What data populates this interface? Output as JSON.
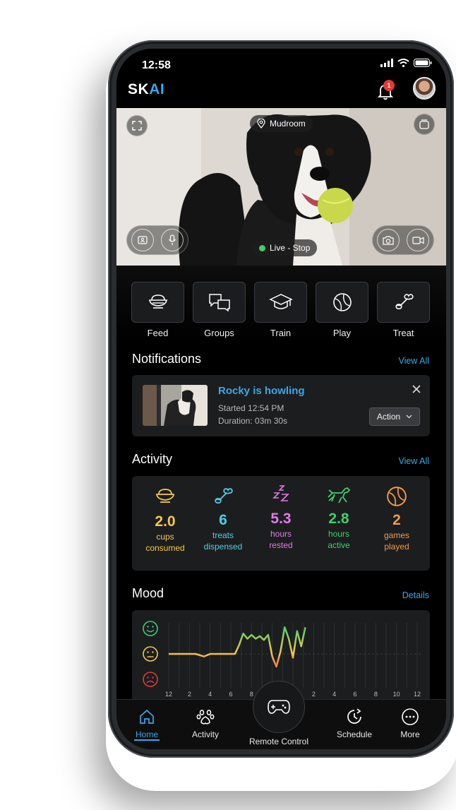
{
  "status_bar": {
    "time": "12:58"
  },
  "header": {
    "logo_sk": "SK",
    "logo_ai": "AI",
    "notification_count": "1"
  },
  "camera": {
    "location": "Mudroom",
    "live_label": "Live - Stop"
  },
  "quick_actions": [
    {
      "label": "Feed",
      "icon": "food-bowl-icon"
    },
    {
      "label": "Groups",
      "icon": "chat-bubbles-icon"
    },
    {
      "label": "Train",
      "icon": "graduation-cap-icon"
    },
    {
      "label": "Play",
      "icon": "ball-icon"
    },
    {
      "label": "Treat",
      "icon": "bone-icon"
    }
  ],
  "notifications": {
    "title": "Notifications",
    "view_all": "View All",
    "item": {
      "title": "Rocky is howling",
      "started": "Started 12:54 PM",
      "duration": "Duration: 03m 30s",
      "action_label": "Action"
    }
  },
  "activity": {
    "title": "Activity",
    "view_all": "View All",
    "stats": [
      {
        "value": "2.0",
        "line1": "cups",
        "line2": "consumed",
        "color": "#f2c94c",
        "icon": "food-bowl-icon"
      },
      {
        "value": "6",
        "line1": "treats",
        "line2": "dispensed",
        "color": "#4fd1e8",
        "icon": "bone-icon"
      },
      {
        "value": "5.3",
        "line1": "hours",
        "line2": "rested",
        "color": "#e07be8",
        "icon": "sleep-icon"
      },
      {
        "value": "2.8",
        "line1": "hours",
        "line2": "active",
        "color": "#3ecf6e",
        "icon": "running-dog-icon"
      },
      {
        "value": "2",
        "line1": "games",
        "line2": "played",
        "color": "#f2994a",
        "icon": "ball-icon"
      }
    ]
  },
  "mood": {
    "title": "Mood",
    "details": "Details",
    "colors": {
      "happy": "#3ecf6e",
      "neutral": "#f2c94c",
      "sad": "#e53935"
    }
  },
  "chart_data": {
    "type": "line",
    "title": "",
    "x_ticks": [
      "12",
      "2",
      "4",
      "6",
      "8",
      "10",
      "12",
      "2",
      "4",
      "6",
      "8",
      "10",
      "12"
    ],
    "y_levels": [
      "sad",
      "neutral",
      "happy"
    ],
    "ylim": [
      0,
      2
    ],
    "series": [
      {
        "x": [
          0,
          1.0,
          1.3,
          1.7,
          2.0,
          2.3,
          2.6,
          2.9,
          3.2,
          3.4,
          3.6,
          3.8,
          4.0,
          4.2,
          4.4,
          4.6,
          4.8,
          5.0,
          5.2,
          5.4,
          5.6,
          5.8,
          6.0,
          6.2,
          6.4,
          6.6
        ],
        "y": [
          1.0,
          1.0,
          1.0,
          0.9,
          1.0,
          1.0,
          1.0,
          1.0,
          1.0,
          1.35,
          1.8,
          1.6,
          1.75,
          1.6,
          1.7,
          1.55,
          1.75,
          0.9,
          0.5,
          1.1,
          2.05,
          1.6,
          0.85,
          1.9,
          1.3,
          2.05
        ]
      }
    ]
  },
  "bottom_nav": {
    "home": "Home",
    "activity": "Activity",
    "remote": "Remote Control",
    "schedule": "Schedule",
    "more": "More"
  }
}
